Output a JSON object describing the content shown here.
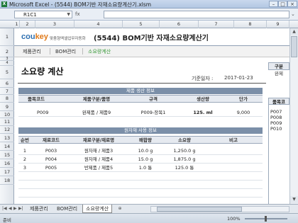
{
  "window": {
    "title": "Microsoft Excel - (5544) BOM기반 자재소요량계산기.xlsm",
    "icon": "excel-icon"
  },
  "formula_bar": {
    "name_box": "R1C1",
    "fx_symbol": "fx",
    "formula": ""
  },
  "columns": [
    "1",
    "2",
    "3",
    "4",
    "5",
    "6",
    "7",
    "8",
    "9"
  ],
  "rows": [
    "1",
    "2",
    "3",
    "4",
    "5",
    "6",
    "7",
    "8",
    "9",
    "10",
    "11",
    "12",
    "13",
    "14",
    "15",
    "16",
    "17",
    "18"
  ],
  "header": {
    "logo_main": "cou",
    "logo_accent": "key",
    "logo_sub": "맞춤형엑셀업무자동화",
    "app_name": "(5544) BOM기반 자재소요량계산기"
  },
  "nav": {
    "items": [
      "제품관리",
      "BOM관리",
      "소요량계산"
    ],
    "active_index": 2,
    "active_color": "#3c9b3c"
  },
  "sheet": {
    "title": "소요량 계산",
    "date_label": "기준일자 :",
    "date_value": "2017-01-23"
  },
  "production": {
    "section_title": "제품 생산 정보",
    "headers": [
      "품목코드",
      "제품구분/품명",
      "규격",
      "생산량",
      "단가"
    ],
    "row": [
      "P009",
      "완제품 / 제품9",
      "P009-장목1",
      "125. ml",
      "9,000"
    ]
  },
  "materials": {
    "section_title": "원자재 사용 정보",
    "headers": [
      "순번",
      "재료코드",
      "재료구분/재료명",
      "배합량",
      "소요량",
      "비고"
    ],
    "rows": [
      [
        "1",
        "P003",
        "원자재 / 제품3",
        "10.0 g",
        "1,250.0 g",
        ""
      ],
      [
        "2",
        "P004",
        "원자재 / 제품4",
        "15.0 g",
        "1,875.0 g",
        ""
      ],
      [
        "3",
        "P005",
        "반제품 / 제품5",
        "1.0 통",
        "125.0 통",
        ""
      ]
    ]
  },
  "right_panel": {
    "header": "구분",
    "sub": "완제",
    "list_header": "품목코",
    "list": [
      "P007",
      "P008",
      "P009",
      "P010"
    ]
  },
  "sheet_tabs": {
    "tabs": [
      "제품관리",
      "BOM관리",
      "소요량계산"
    ],
    "active_index": 2
  },
  "status": {
    "ready": "준비",
    "zoom": "100%"
  }
}
